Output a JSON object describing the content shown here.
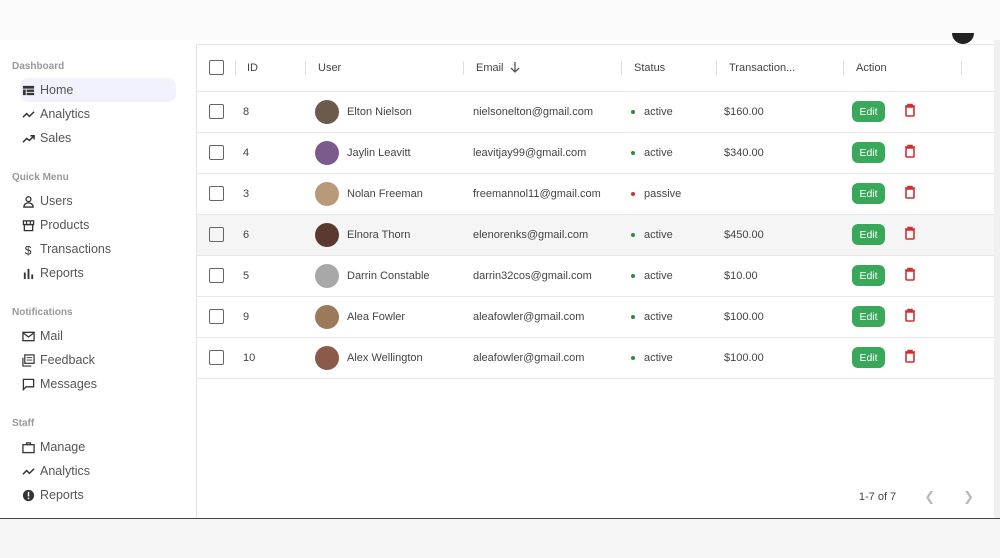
{
  "sidebar": {
    "sections": [
      {
        "title": "Dashboard",
        "items": [
          {
            "label": "Home",
            "icon": "dashboard-icon",
            "active": true
          },
          {
            "label": "Analytics",
            "icon": "trending-icon"
          },
          {
            "label": "Sales",
            "icon": "trending-up-icon"
          }
        ]
      },
      {
        "title": "Quick Menu",
        "items": [
          {
            "label": "Users",
            "icon": "person-icon"
          },
          {
            "label": "Products",
            "icon": "storefront-icon"
          },
          {
            "label": "Transactions",
            "icon": "dollar-icon"
          },
          {
            "label": "Reports",
            "icon": "bar-chart-icon"
          }
        ]
      },
      {
        "title": "Notifications",
        "items": [
          {
            "label": "Mail",
            "icon": "mail-icon"
          },
          {
            "label": "Feedback",
            "icon": "feedback-icon"
          },
          {
            "label": "Messages",
            "icon": "message-icon"
          }
        ]
      },
      {
        "title": "Staff",
        "items": [
          {
            "label": "Manage",
            "icon": "work-icon"
          },
          {
            "label": "Analytics",
            "icon": "timeline-icon"
          },
          {
            "label": "Reports",
            "icon": "report-icon"
          }
        ]
      }
    ]
  },
  "table": {
    "headers": {
      "id": "ID",
      "user": "User",
      "email": "Email",
      "status": "Status",
      "transaction": "Transaction...",
      "action": "Action"
    },
    "sort_icon": "arrow-down-icon",
    "edit_label": "Edit",
    "rows": [
      {
        "id": "8",
        "user": "Elton Nielson",
        "email": "nielsonelton@gmail.com",
        "status": "active",
        "transaction": "$160.00",
        "avatar": "#6b5a4e"
      },
      {
        "id": "4",
        "user": "Jaylin Leavitt",
        "email": "leavitjay99@gmail.com",
        "status": "active",
        "transaction": "$340.00",
        "avatar": "#7a5a8a"
      },
      {
        "id": "3",
        "user": "Nolan Freeman",
        "email": "freemannol11@gmail.com",
        "status": "passive",
        "transaction": "",
        "avatar": "#b89a7a"
      },
      {
        "id": "6",
        "user": "Elnora Thorn",
        "email": "elenorenks@gmail.com",
        "status": "active",
        "transaction": "$450.00",
        "avatar": "#5a3a30"
      },
      {
        "id": "5",
        "user": "Darrin Constable",
        "email": "darrin32cos@gmail.com",
        "status": "active",
        "transaction": "$10.00",
        "avatar": "#a8a8a8"
      },
      {
        "id": "9",
        "user": "Alea Fowler",
        "email": "aleafowler@gmail.com",
        "status": "active",
        "transaction": "$100.00",
        "avatar": "#9a7a5a"
      },
      {
        "id": "10",
        "user": "Alex Wellington",
        "email": "aleafowler@gmail.com",
        "status": "active",
        "transaction": "$100.00",
        "avatar": "#8a5a4a"
      }
    ]
  },
  "pagination": {
    "label": "1-7 of 7",
    "prev_icon": "chevron-left-icon",
    "next_icon": "chevron-right-icon"
  },
  "colors": {
    "active": "#2e8b3e",
    "passive": "#d93030",
    "edit": "#3aa85a",
    "delete": "#d32f2f"
  }
}
